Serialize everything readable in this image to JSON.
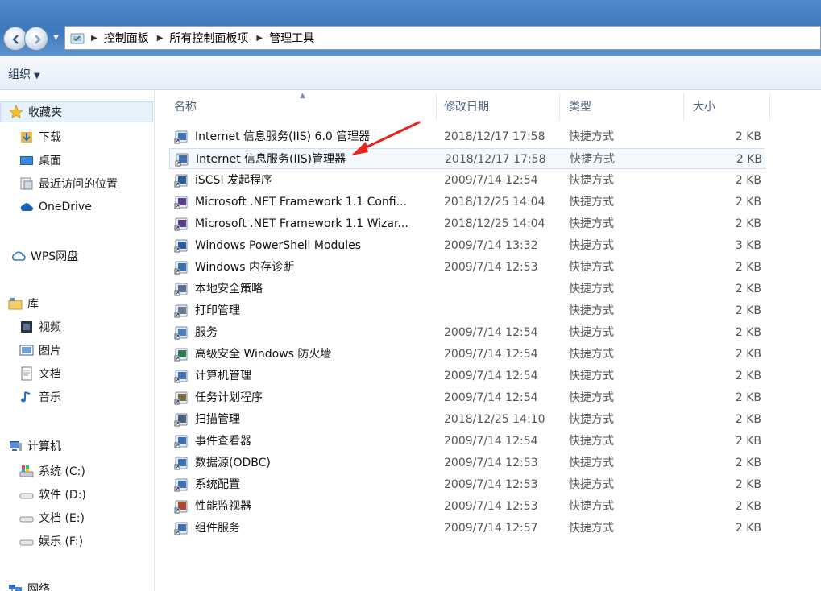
{
  "address": {
    "crumbs": [
      "控制面板",
      "所有控制面板项",
      "管理工具"
    ]
  },
  "toolbar": {
    "organize_label": "组织",
    "organize_caret": "▼"
  },
  "sidebar": {
    "favorites": {
      "label": "收藏夹",
      "items": [
        "下载",
        "桌面",
        "最近访问的位置",
        "OneDrive"
      ]
    },
    "wps": {
      "label": "WPS网盘"
    },
    "library": {
      "label": "库",
      "items": [
        "视频",
        "图片",
        "文档",
        "音乐"
      ]
    },
    "computer": {
      "label": "计算机",
      "items": [
        "系统 (C:)",
        "软件 (D:)",
        "文档 (E:)",
        "娱乐 (F:)"
      ]
    },
    "network": {
      "label": "网络"
    }
  },
  "columns": {
    "name": "名称",
    "date": "修改日期",
    "type": "类型",
    "size": "大小"
  },
  "files": [
    {
      "name": "Internet 信息服务(IIS) 6.0 管理器",
      "date": "2018/12/17 17:58",
      "type": "快捷方式",
      "size": "2 KB"
    },
    {
      "name": "Internet 信息服务(IIS)管理器",
      "date": "2018/12/17 17:58",
      "type": "快捷方式",
      "size": "2 KB"
    },
    {
      "name": "iSCSI 发起程序",
      "date": "2009/7/14 12:54",
      "type": "快捷方式",
      "size": "2 KB"
    },
    {
      "name": "Microsoft .NET Framework 1.1 Confi...",
      "date": "2018/12/25 14:04",
      "type": "快捷方式",
      "size": "2 KB"
    },
    {
      "name": "Microsoft .NET Framework 1.1 Wizar...",
      "date": "2018/12/25 14:04",
      "type": "快捷方式",
      "size": "2 KB"
    },
    {
      "name": "Windows PowerShell Modules",
      "date": "2009/7/14 13:32",
      "type": "快捷方式",
      "size": "3 KB"
    },
    {
      "name": "Windows 内存诊断",
      "date": "2009/7/14 12:53",
      "type": "快捷方式",
      "size": "2 KB"
    },
    {
      "name": "本地安全策略",
      "date": "",
      "type": "快捷方式",
      "size": "2 KB"
    },
    {
      "name": "打印管理",
      "date": "",
      "type": "快捷方式",
      "size": "2 KB"
    },
    {
      "name": "服务",
      "date": "2009/7/14 12:54",
      "type": "快捷方式",
      "size": "2 KB"
    },
    {
      "name": "高级安全 Windows 防火墙",
      "date": "2009/7/14 12:54",
      "type": "快捷方式",
      "size": "2 KB"
    },
    {
      "name": "计算机管理",
      "date": "2009/7/14 12:54",
      "type": "快捷方式",
      "size": "2 KB"
    },
    {
      "name": "任务计划程序",
      "date": "2009/7/14 12:54",
      "type": "快捷方式",
      "size": "2 KB"
    },
    {
      "name": "扫描管理",
      "date": "2018/12/25 14:10",
      "type": "快捷方式",
      "size": "2 KB"
    },
    {
      "name": "事件查看器",
      "date": "2009/7/14 12:54",
      "type": "快捷方式",
      "size": "2 KB"
    },
    {
      "name": "数据源(ODBC)",
      "date": "2009/7/14 12:53",
      "type": "快捷方式",
      "size": "2 KB"
    },
    {
      "name": "系统配置",
      "date": "2009/7/14 12:53",
      "type": "快捷方式",
      "size": "2 KB"
    },
    {
      "name": "性能监视器",
      "date": "2009/7/14 12:53",
      "type": "快捷方式",
      "size": "2 KB"
    },
    {
      "name": "组件服务",
      "date": "2009/7/14 12:57",
      "type": "快捷方式",
      "size": "2 KB"
    }
  ],
  "selected_file_index": 1,
  "colors": {
    "annotation_arrow": "#e8231a",
    "title_blue": "#3d78bd",
    "selection": "#e5f1fb"
  }
}
